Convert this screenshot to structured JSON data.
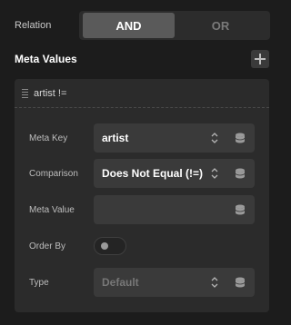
{
  "relation": {
    "label": "Relation",
    "options": [
      "AND",
      "OR"
    ],
    "selected": "AND"
  },
  "meta_values": {
    "title": "Meta Values"
  },
  "item": {
    "title": "artist !=",
    "fields": {
      "meta_key": {
        "label": "Meta Key",
        "value": "artist"
      },
      "comparison": {
        "label": "Comparison",
        "value": "Does Not Equal (!=)"
      },
      "meta_value": {
        "label": "Meta Value",
        "value": ""
      },
      "order_by": {
        "label": "Order By",
        "enabled": false
      },
      "type": {
        "label": "Type",
        "placeholder": "Default"
      }
    }
  },
  "icons": [
    "plus-icon",
    "drag-handle-icon",
    "chevron-updown-icon",
    "database-icon"
  ],
  "colors": {
    "background": "#1c1c1c",
    "panel": "#2b2b2b",
    "field": "#3a3a3a",
    "active_segment": "#5a5a5a"
  }
}
